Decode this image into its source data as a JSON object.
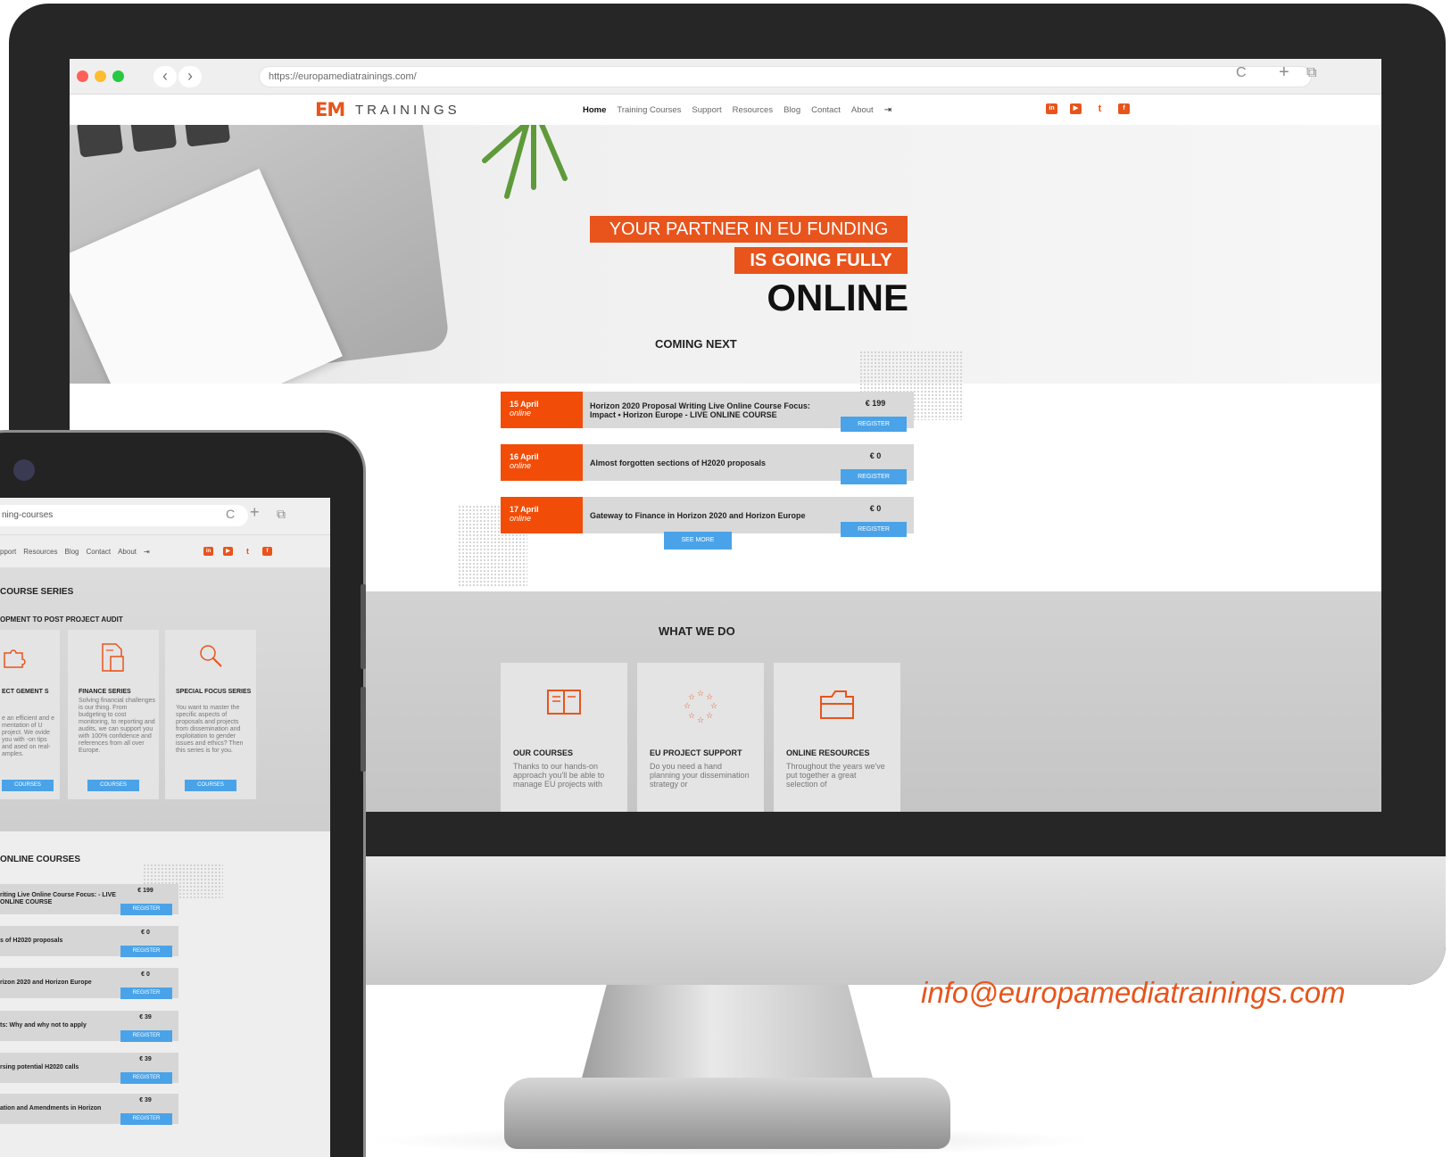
{
  "browser": {
    "url": "https://europamediatrainings.com/",
    "back_glyph": "‹",
    "forward_glyph": "›",
    "reload_glyph": "C",
    "newtab_glyph": "+",
    "tabs_glyph": "⧉"
  },
  "header": {
    "logo_mark": "EM",
    "logo_text": "TRAININGS",
    "nav": [
      "Home",
      "Training Courses",
      "Support",
      "Resources",
      "Blog",
      "Contact",
      "About"
    ],
    "login_glyph": "⇥",
    "social": [
      {
        "icon": "linkedin-icon",
        "glyph": "in"
      },
      {
        "icon": "youtube-icon",
        "glyph": "▶"
      },
      {
        "icon": "twitter-icon",
        "glyph": "t"
      },
      {
        "icon": "facebook-icon",
        "glyph": "f"
      }
    ]
  },
  "hero": {
    "line1": "YOUR PARTNER IN EU FUNDING",
    "line2": "IS GOING FULLY",
    "line3": "ONLINE"
  },
  "coming_next": {
    "title": "COMING NEXT",
    "events": [
      {
        "date": "15 April",
        "mode": "online",
        "title": "Horizon 2020 Proposal Writing Live Online Course Focus: Impact • Horizon Europe - LIVE ONLINE COURSE",
        "price": "€ 199",
        "button": "REGISTER"
      },
      {
        "date": "16 April",
        "mode": "online",
        "title": "Almost forgotten sections of H2020 proposals",
        "price": "€ 0",
        "button": "REGISTER"
      },
      {
        "date": "17 April",
        "mode": "online",
        "title": "Gateway to Finance in Horizon 2020 and Horizon Europe",
        "price": "€ 0",
        "button": "REGISTER"
      }
    ],
    "see_more": "SEE MORE"
  },
  "what_we_do": {
    "title": "WHAT WE DO",
    "cards": [
      {
        "icon": "book-icon",
        "title": "OUR COURSES",
        "text": "Thanks to our hands-on approach you'll be able to manage EU projects with"
      },
      {
        "icon": "eu-stars-icon",
        "title": "EU PROJECT SUPPORT",
        "text": "Do you need a hand planning your dissemination strategy or"
      },
      {
        "icon": "folder-icon",
        "title": "ONLINE RESOURCES",
        "text": "Throughout the years we've put together a great selection of"
      }
    ]
  },
  "tablet": {
    "url": "ning-courses",
    "nav": [
      "pport",
      "Resources",
      "Blog",
      "Contact",
      "About"
    ],
    "series_title": "COURSE SERIES",
    "series_subtitle": "OPMENT TO POST PROJECT AUDIT",
    "cards": [
      {
        "icon": "puzzle-icon",
        "title": "ECT GEMENT S",
        "text": "e an efficient and e mentation of U project. We ovide you with -on tips and ased on real- amples.",
        "button": "COURSES"
      },
      {
        "icon": "calculator-doc-icon",
        "title": "FINANCE SERIES",
        "text": "Solving financial challenges is our thing. From budgeting to cost monitoring, to reporting and audits, we can support you with 100% confidence and references from all over Europe.",
        "button": "COURSES"
      },
      {
        "icon": "magnifier-icon",
        "title": "SPECIAL FOCUS SERIES",
        "text": "You want to master the specific aspects of proposals and projects from dissemination and exploitation to gender issues and ethics? Then this series is for you.",
        "button": "COURSES"
      }
    ],
    "online_title": "ONLINE COURSES",
    "events": [
      {
        "title": "riting Live Online Course Focus: - LIVE ONLINE COURSE",
        "price": "€ 199",
        "button": "REGISTER"
      },
      {
        "title": "s of H2020 proposals",
        "price": "€ 0",
        "button": "REGISTER"
      },
      {
        "title": "rizon 2020 and Horizon Europe",
        "price": "€ 0",
        "button": "REGISTER"
      },
      {
        "title": "ts: Why and why not to apply",
        "price": "€ 39",
        "button": "REGISTER"
      },
      {
        "title": "rsing potential H2020 calls",
        "price": "€ 39",
        "button": "REGISTER"
      },
      {
        "title": "ation and Amendments in Horizon",
        "price": "€ 39",
        "button": "REGISTER"
      }
    ]
  },
  "email": "info@europamediatrainings.com",
  "colors": {
    "accent": "#e8541c",
    "button": "#4aa3e8"
  }
}
